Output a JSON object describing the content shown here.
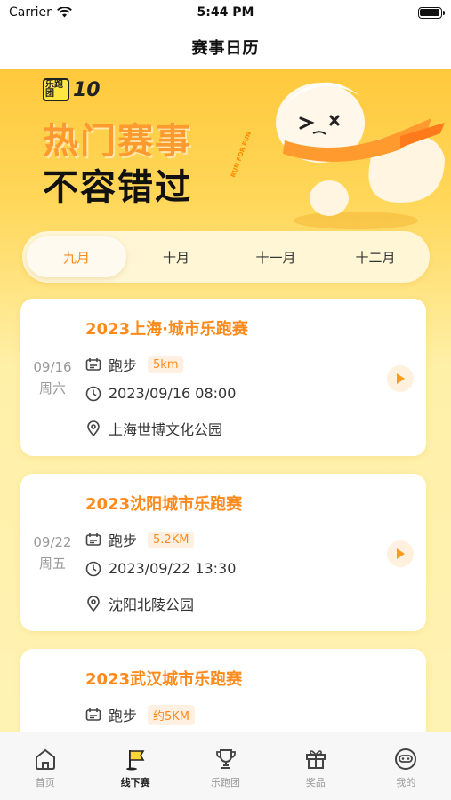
{
  "status_bar": {
    "carrier": "Carrier",
    "time": "5:44 PM"
  },
  "nav": {
    "title": "赛事日历"
  },
  "banner": {
    "brand_logo": "乐跑团",
    "brand_ten": "10",
    "line1": "热门赛事",
    "line2": "不容错过",
    "slogan": "RUN FOR FUN"
  },
  "month_tabs": [
    {
      "label": "九月",
      "active": true
    },
    {
      "label": "十月",
      "active": false
    },
    {
      "label": "十一月",
      "active": false
    },
    {
      "label": "十二月",
      "active": false
    }
  ],
  "events": [
    {
      "date": "09/16",
      "weekday": "周六",
      "title": "2023上海·城市乐跑赛",
      "type": "跑步",
      "distance": "5km",
      "datetime": "2023/09/16 08:00",
      "location": "上海世博文化公园"
    },
    {
      "date": "09/22",
      "weekday": "周五",
      "title": "2023沈阳城市乐跑赛",
      "type": "跑步",
      "distance": "5.2KM",
      "datetime": "2023/09/22 13:30",
      "location": "沈阳北陵公园"
    },
    {
      "date": "",
      "weekday": "",
      "title": "2023武汉城市乐跑赛",
      "type": "跑步",
      "distance": "约5KM",
      "datetime": "",
      "location": ""
    }
  ],
  "tabbar": [
    {
      "label": "首页",
      "icon": "home-icon",
      "active": false
    },
    {
      "label": "线下赛",
      "icon": "flag-icon",
      "active": true
    },
    {
      "label": "乐跑团",
      "icon": "trophy-icon",
      "active": false
    },
    {
      "label": "奖品",
      "icon": "gift-icon",
      "active": false
    },
    {
      "label": "我的",
      "icon": "profile-icon",
      "active": false
    }
  ],
  "colors": {
    "accent": "#ff8a1c",
    "banner_yellow": "#ffc93c",
    "background_yellow": "#fff3b4"
  }
}
